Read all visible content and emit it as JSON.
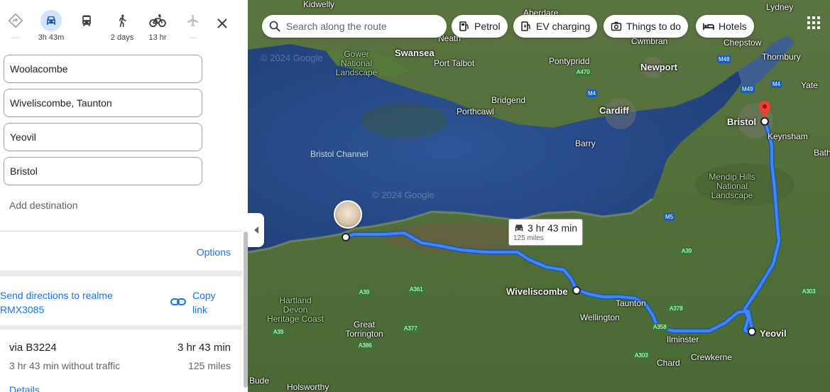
{
  "travel_modes": [
    {
      "name": "best",
      "label": "—"
    },
    {
      "name": "driving",
      "label": "3h 43m"
    },
    {
      "name": "transit",
      "label": ""
    },
    {
      "name": "walking",
      "label": "2 days"
    },
    {
      "name": "cycling",
      "label": "13 hr"
    },
    {
      "name": "flights",
      "label": "—"
    }
  ],
  "waypoints": [
    "Woolacombe",
    "Wiveliscombe, Taunton",
    "Yeovil",
    "Bristol"
  ],
  "add_destination": "Add destination",
  "options_label": "Options",
  "send_directions": "Send directions to realme RMX3085",
  "copy_link": "Copy link",
  "route": {
    "via": "via B3224",
    "time": "3 hr 43 min",
    "without_traffic": "3 hr 43 min without traffic",
    "distance": "125 miles",
    "details": "Details"
  },
  "map": {
    "search_placeholder": "Search along the route",
    "chips": [
      "Petrol",
      "EV charging",
      "Things to do",
      "Hotels"
    ],
    "route_card": {
      "time": "3 hr 43 min",
      "distance": "125 miles"
    },
    "watermark": "© 2024 Google",
    "places": {
      "kidwelly": "Kidwelly",
      "aberdare": "Aberdare",
      "neath": "Neath",
      "swansea": "Swansea",
      "port_talbot": "Port Talbot",
      "pontypridd": "Pontypridd",
      "cwmbran": "Cwmbran",
      "newport": "Newport",
      "chepstow": "Chepstow",
      "lydney": "Lydney",
      "thornbury": "Thornbury",
      "yate": "Yate",
      "gower": "Gower\nNational\nLandscape",
      "bridgend": "Bridgend",
      "porthcawl": "Porthcawl",
      "cardiff": "Cardiff",
      "barry": "Barry",
      "bristol": "Bristol",
      "keynsham": "Keynsham",
      "bath": "Bath",
      "bristol_channel": "Bristol Channel",
      "mendip": "Mendip Hills\nNational\nLandscape",
      "wiveliscombe": "Wiveliscombe",
      "taunton": "Taunton",
      "wellington": "Wellington",
      "hartland": "Hartland\nDevon\nHeritage Coast",
      "great_torrington": "Great\nTorrington",
      "ilminster": "Ilminster",
      "crewkerne": "Crewkerne",
      "yeovil": "Yeovil",
      "chard": "Chard",
      "bude": "Bude",
      "holsworthy": "Holsworthy"
    },
    "roads": [
      "A470",
      "M4",
      "M48",
      "M49",
      "M4",
      "M5",
      "A39",
      "A39",
      "A361",
      "A377",
      "A386",
      "A39",
      "A358",
      "A378",
      "A303",
      "A303",
      "A39"
    ]
  },
  "colors": {
    "route": "#3367d6",
    "accent": "#1a73e8",
    "land": "#4f6b3a",
    "sea": "#274a86"
  }
}
